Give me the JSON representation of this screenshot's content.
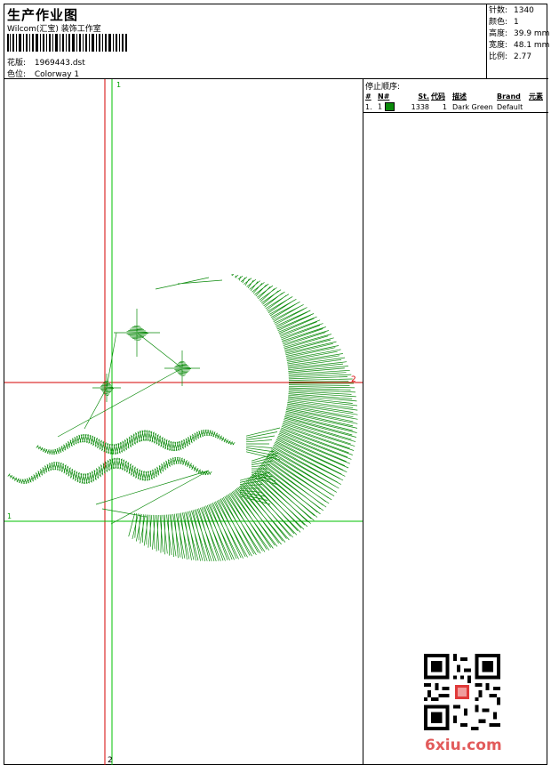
{
  "header": {
    "title": "生产作业图",
    "subtitle": "Wilcom(汇宝) 装饰工作室",
    "design": {
      "label": "花版:",
      "value": "1969443.dst"
    },
    "colorway": {
      "label": "色位:",
      "value": "Colorway 1"
    }
  },
  "stats": [
    {
      "label": "针数:",
      "value": "1340"
    },
    {
      "label": "颜色:",
      "value": "1"
    },
    {
      "label": "高度:",
      "value": "39.9 mm"
    },
    {
      "label": "宽度:",
      "value": "48.1 mm"
    },
    {
      "label": "比例:",
      "value": "2.77"
    }
  ],
  "stoplist": {
    "title": "停止顺序:",
    "columns": [
      "#",
      "N#",
      "St.",
      "代码",
      "描述",
      "Brand",
      "元素"
    ],
    "rows": [
      {
        "num": "1.",
        "n": "1",
        "stitches": "1338",
        "code": "1",
        "description": "Dark Green",
        "brand": "Default",
        "element": "",
        "color": "#0a8a0a"
      }
    ]
  },
  "guides": {
    "red_vertical_label": "2",
    "red_horizontal_label": "2",
    "green_vertical_label": "1",
    "green_horizontal_label": "1"
  },
  "colors": {
    "thread": "#0a8a0a",
    "guide_red": "#d40000",
    "guide_green": "#00c000"
  },
  "watermark": {
    "text": "6xiu.com"
  }
}
